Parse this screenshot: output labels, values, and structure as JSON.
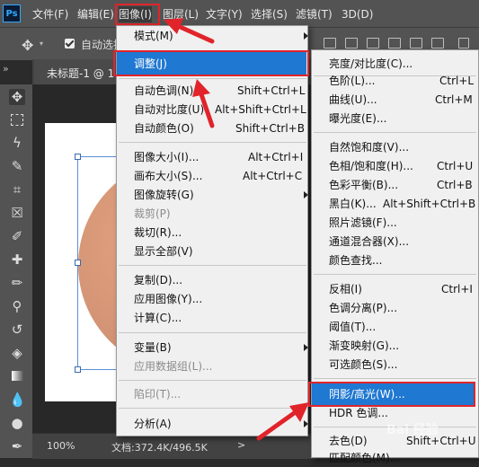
{
  "app": {
    "logo": "Ps"
  },
  "menubar": {
    "items": [
      "文件(F)",
      "编辑(E)",
      "图像(I)",
      "图层(L)",
      "文字(Y)",
      "选择(S)",
      "滤镜(T)",
      "3D(D)"
    ]
  },
  "options_bar": {
    "move_icon": "move-icon",
    "auto_select_label": "自动选择",
    "auto_select_checked": true
  },
  "document_tab": {
    "label": "未标题-1 @ 1",
    "collapse_glyph": "»"
  },
  "status_bar": {
    "zoom": "100%",
    "doc_size": "文档:372.4K/496.5K",
    "arrow": ">"
  },
  "image_menu": {
    "items": [
      {
        "label": "模式(M)",
        "shortcut": "",
        "submenu": true
      },
      {
        "label": "调整(J)",
        "shortcut": "",
        "submenu": true,
        "highlighted": true
      },
      {
        "label": "自动色调(N)",
        "shortcut": "Shift+Ctrl+L"
      },
      {
        "label": "自动对比度(U)",
        "shortcut": "Alt+Shift+Ctrl+L"
      },
      {
        "label": "自动颜色(O)",
        "shortcut": "Shift+Ctrl+B"
      },
      {
        "label": "图像大小(I)...",
        "shortcut": "Alt+Ctrl+I"
      },
      {
        "label": "画布大小(S)...",
        "shortcut": "Alt+Ctrl+C"
      },
      {
        "label": "图像旋转(G)",
        "shortcut": "",
        "submenu": true
      },
      {
        "label": "裁剪(P)",
        "shortcut": "",
        "disabled": true
      },
      {
        "label": "裁切(R)...",
        "shortcut": ""
      },
      {
        "label": "显示全部(V)",
        "shortcut": ""
      },
      {
        "label": "复制(D)...",
        "shortcut": ""
      },
      {
        "label": "应用图像(Y)...",
        "shortcut": ""
      },
      {
        "label": "计算(C)...",
        "shortcut": ""
      },
      {
        "label": "变量(B)",
        "shortcut": "",
        "submenu": true
      },
      {
        "label": "应用数据组(L)...",
        "shortcut": "",
        "disabled": true
      },
      {
        "label": "陷印(T)...",
        "shortcut": "",
        "disabled": true
      },
      {
        "label": "分析(A)",
        "shortcut": "",
        "submenu": true
      }
    ]
  },
  "adjust_menu": {
    "items": [
      {
        "label": "亮度/对比度(C)...",
        "shortcut": ""
      },
      {
        "label": "色阶(L)...",
        "shortcut": "Ctrl+L"
      },
      {
        "label": "曲线(U)...",
        "shortcut": "Ctrl+M"
      },
      {
        "label": "曝光度(E)...",
        "shortcut": ""
      },
      {
        "label": "自然饱和度(V)...",
        "shortcut": ""
      },
      {
        "label": "色相/饱和度(H)...",
        "shortcut": "Ctrl+U"
      },
      {
        "label": "色彩平衡(B)...",
        "shortcut": "Ctrl+B"
      },
      {
        "label": "黑白(K)...",
        "shortcut": "Alt+Shift+Ctrl+B"
      },
      {
        "label": "照片滤镜(F)...",
        "shortcut": ""
      },
      {
        "label": "通道混合器(X)...",
        "shortcut": ""
      },
      {
        "label": "颜色查找...",
        "shortcut": ""
      },
      {
        "label": "反相(I)",
        "shortcut": "Ctrl+I"
      },
      {
        "label": "色调分离(P)...",
        "shortcut": ""
      },
      {
        "label": "阈值(T)...",
        "shortcut": ""
      },
      {
        "label": "渐变映射(G)...",
        "shortcut": ""
      },
      {
        "label": "可选颜色(S)...",
        "shortcut": ""
      },
      {
        "label": "阴影/高光(W)...",
        "shortcut": "",
        "highlighted": true
      },
      {
        "label": "HDR 色调...",
        "shortcut": ""
      },
      {
        "label": "去色(D)",
        "shortcut": "Shift+Ctrl+U"
      },
      {
        "label": "匹配颜色(M)...",
        "shortcut": ""
      }
    ]
  },
  "colors": {
    "menubar_bg": "#535353",
    "menu_bg": "#f0f0f0",
    "highlight": "#1f78d1",
    "annotation": "#e0242a",
    "canvas_object": "#d49576"
  },
  "watermark": "Bai 经验"
}
